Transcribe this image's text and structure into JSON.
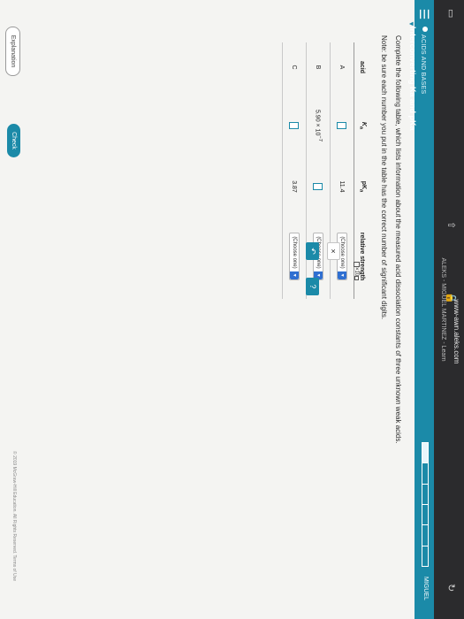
{
  "browser": {
    "address": "www-awn.aleks.com",
    "tab_title": "ALEKS - MIGUEL MARTINEZ - Learn"
  },
  "header": {
    "section": "ACIDS AND BASES",
    "title": "Interconverting Ka and pKa",
    "user": "MIGUEL",
    "progress": {
      "filled": 1,
      "total": 6
    }
  },
  "question": {
    "instructions": "Complete the following table, which lists information about the measured acid dissociation constants of three unknown weak acids.",
    "note": "Note: be sure each number you put in the table has the correct number of significant digits."
  },
  "table": {
    "headers": {
      "acid": "acid",
      "ka": "K",
      "ka_sub": "a",
      "pka": "pK",
      "pka_sub": "a",
      "relative": "relative strength"
    },
    "rows": [
      {
        "acid": "A",
        "pka": "11.4",
        "choose": "(Choose one)"
      },
      {
        "acid": "B",
        "ka_mantissa": "5.90 × 10",
        "ka_exp": "−7",
        "choose": "(Choose one)"
      },
      {
        "acid": "C",
        "pka": "3.87",
        "choose": "(Choose one)"
      }
    ]
  },
  "tools": {
    "sci_label": "×10",
    "close": "×",
    "undo": "↶",
    "help": "?"
  },
  "footer": {
    "explanation": "Explanation",
    "check": "Check",
    "copyright": "© 2019 McGraw-Hill Education. All Rights Reserved.   Terms of Use"
  }
}
